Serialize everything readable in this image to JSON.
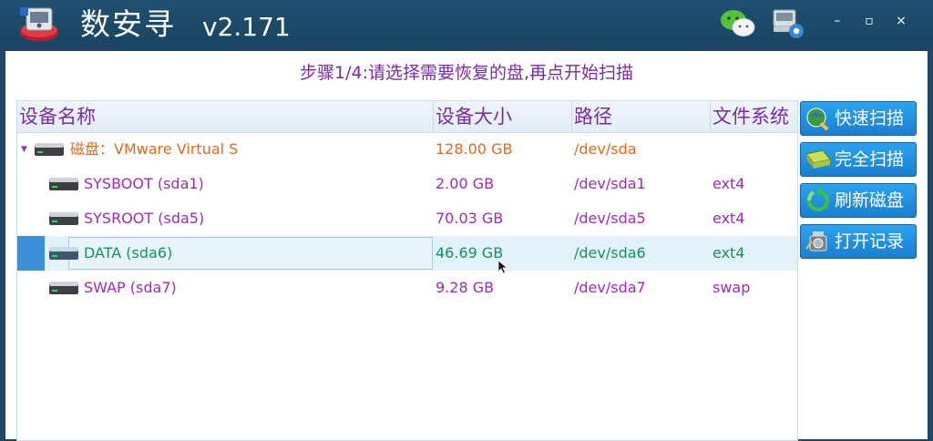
{
  "app": {
    "title": "数安寻",
    "version": "v2.171",
    "logo_icon": "app-logo-icon",
    "window_controls": {
      "minimize": "–",
      "maximize": "▫",
      "close": "×"
    }
  },
  "step": {
    "text": "步骤1/4:请选择需要恢复的盘,再点开始扫描"
  },
  "table": {
    "columns": [
      "设备名称",
      "设备大小",
      "路径",
      "文件系统"
    ],
    "rows": [
      {
        "name": "磁盘：VMware Virtual S",
        "size": "128.00 GB",
        "path": "/dev/sda",
        "fs": "",
        "level": 0,
        "expanded": true
      },
      {
        "name": "SYSBOOT (sda1)",
        "size": "2.00 GB",
        "path": "/dev/sda1",
        "fs": "ext4",
        "level": 1
      },
      {
        "name": "SYSROOT (sda5)",
        "size": "70.03 GB",
        "path": "/dev/sda5",
        "fs": "ext4",
        "level": 1
      },
      {
        "name": "DATA (sda6)",
        "size": "46.69 GB",
        "path": "/dev/sda6",
        "fs": "ext4",
        "level": 1,
        "selected": true
      },
      {
        "name": "SWAP (sda7)",
        "size": "9.28 GB",
        "path": "/dev/sda7",
        "fs": "swap",
        "level": 1
      }
    ]
  },
  "buttons": {
    "quick_scan": "快速扫描",
    "full_scan": "完全扫描",
    "refresh": "刷新磁盘",
    "open_log": "打开记录"
  },
  "colors": {
    "titlebar": "#1e4a68",
    "header_text": "#7a2ca3",
    "disk_text": "#e06a1c",
    "partition_text": "#a02ab8",
    "selected_text": "#16925e",
    "button": "#1f8fe0"
  }
}
